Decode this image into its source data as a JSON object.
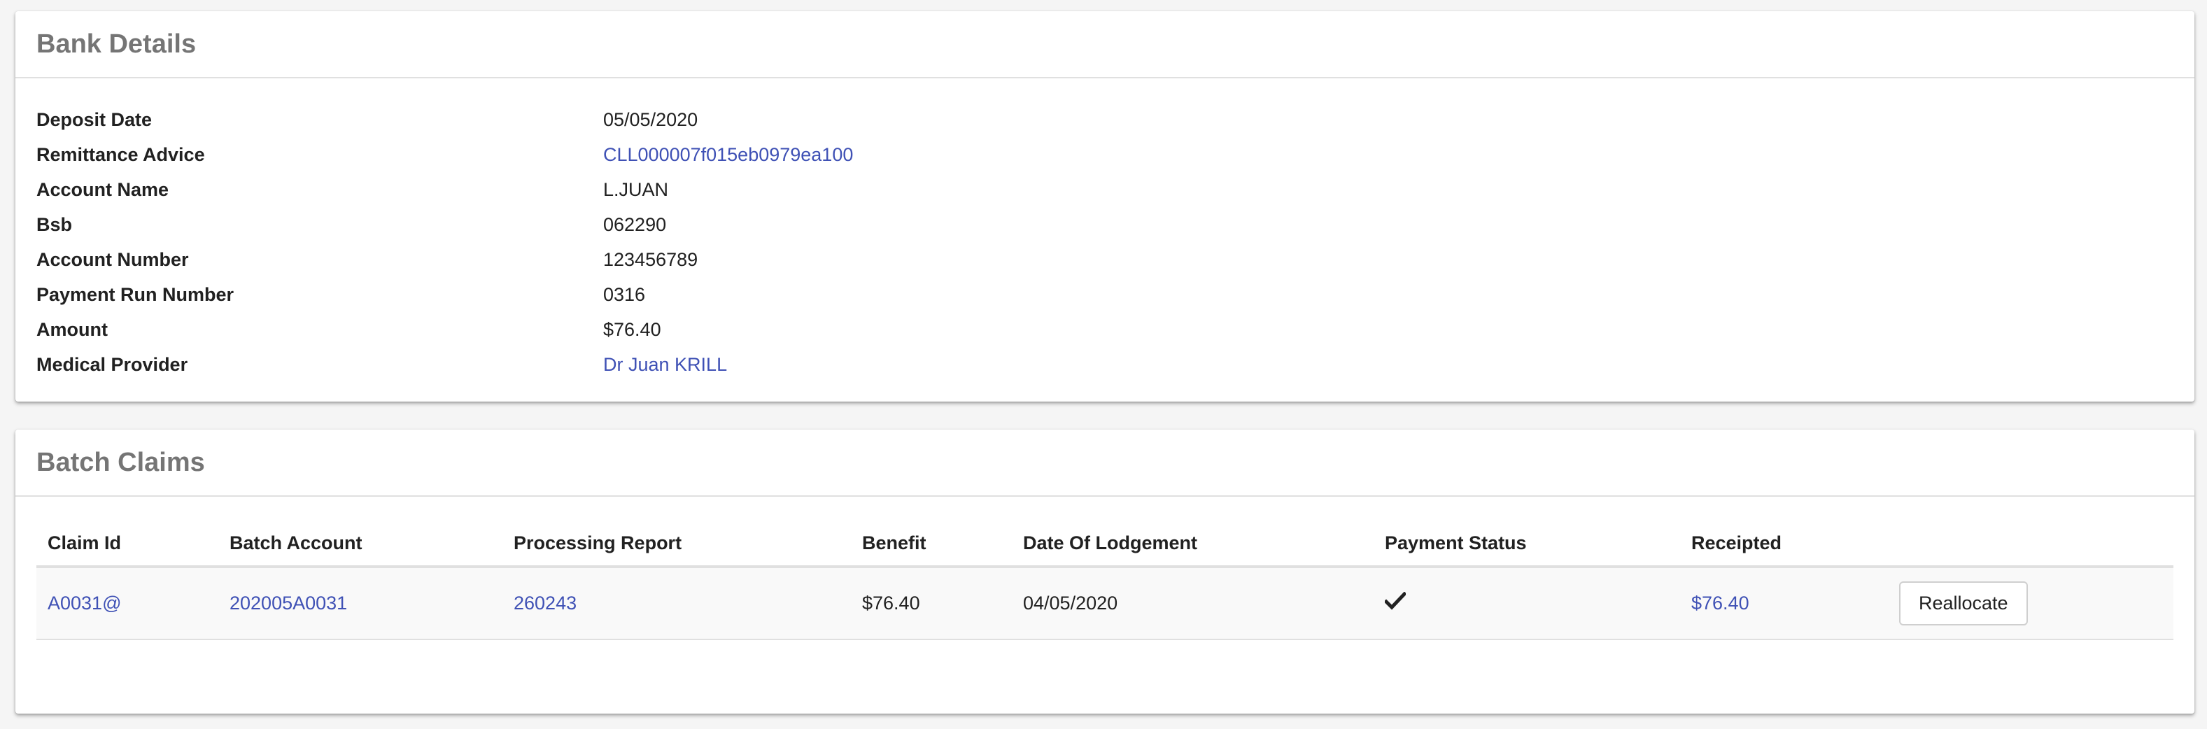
{
  "bank_details": {
    "title": "Bank Details",
    "rows": [
      {
        "label": "Deposit Date",
        "value": "05/05/2020"
      },
      {
        "label": "Remittance Advice",
        "value": "CLL000007f015eb0979ea100"
      },
      {
        "label": "Account Name",
        "value": "L.JUAN"
      },
      {
        "label": "Bsb",
        "value": "062290"
      },
      {
        "label": "Account Number",
        "value": "123456789"
      },
      {
        "label": "Payment Run Number",
        "value": "0316"
      },
      {
        "label": "Amount",
        "value": "$76.40"
      },
      {
        "label": "Medical Provider",
        "value": "Dr Juan KRILL"
      }
    ]
  },
  "batch_claims": {
    "title": "Batch Claims",
    "headers": {
      "claim_id": "Claim Id",
      "batch_account": "Batch Account",
      "processing_report": "Processing Report",
      "benefit": "Benefit",
      "date_of_lodgement": "Date Of Lodgement",
      "payment_status": "Payment Status",
      "receipted": "Receipted"
    },
    "rows": [
      {
        "claim_id": "A0031@",
        "batch_account": "202005A0031",
        "processing_report": "260243",
        "benefit": "$76.40",
        "date_of_lodgement": "04/05/2020",
        "payment_status_icon": "check-icon",
        "receipted": "$76.40",
        "action_label": "Reallocate"
      }
    ]
  },
  "colors": {
    "link": "#3f51b5",
    "title": "#757575",
    "background": "#f5f5f5"
  }
}
